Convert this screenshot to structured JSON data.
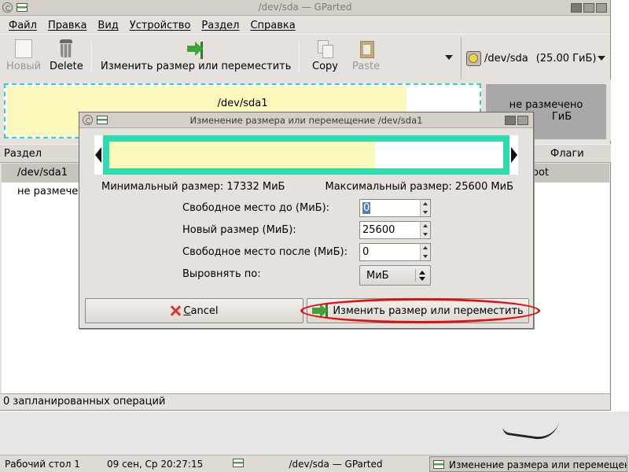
{
  "window": {
    "title": "/dev/sda — GParted"
  },
  "menu": [
    "Файл",
    "Правка",
    "Вид",
    "Устройство",
    "Раздел",
    "Справка"
  ],
  "toolbar": {
    "new": "Новый",
    "delete": "Delete",
    "resize_move": "Изменить размер или переместить",
    "copy": "Copy",
    "paste": "Paste",
    "device": "/dev/sda",
    "device_size": "(25.00 ГиБ)"
  },
  "diskmap": {
    "partition": "/dev/sda1",
    "unallocated_label": "не размечено",
    "unallocated_size_partial": "ГиБ"
  },
  "table": {
    "headers": {
      "partition": "Раздел",
      "flags": "Флаги"
    },
    "rows": [
      {
        "partition": "/dev/sda1",
        "flags_partial": "oot"
      },
      {
        "partition": "не размече"
      }
    ]
  },
  "status": "0 запланированных операций",
  "dialog": {
    "title": "Изменение размера или перемещение /dev/sda1",
    "min_size": "Минимальный размер: 17332 МиБ",
    "max_size": "Максимальный размер: 25600 МиБ",
    "free_before_label": "Свободное место до (МиБ):",
    "free_before_value": "0",
    "new_size_label": "Новый размер (МиБ):",
    "new_size_value": "25600",
    "free_after_label": "Свободное место после (МиБ):",
    "free_after_value": "0",
    "align_label": "Выровнять по:",
    "align_value": "МиБ",
    "cancel": "Cancel",
    "apply": "Изменить размер или переместить"
  },
  "taskbar": {
    "workspace": "Рабочий стол 1",
    "clock": "09 сен, Ср 20:27:15",
    "task1": "/dev/sda — GParted",
    "task2": "Изменение размера или перемещени"
  },
  "colors": {
    "partition_border": "#2fdcaf",
    "used_space": "#fbf8bc",
    "unallocated": "#a8a8a8",
    "highlight_ring": "#e01010"
  }
}
